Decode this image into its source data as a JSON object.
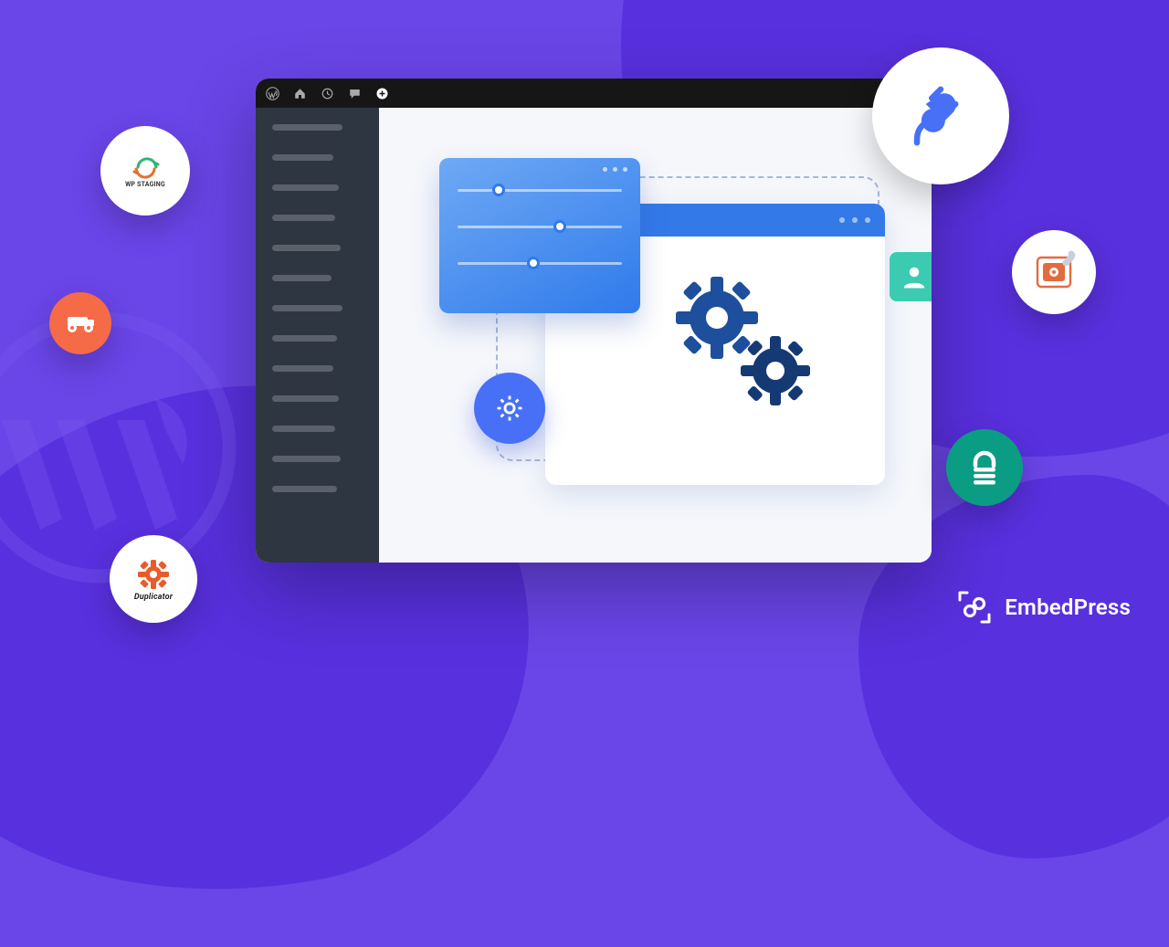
{
  "brand": {
    "name": "EmbedPress"
  },
  "badges": {
    "wpstaging": "WP   STAGING",
    "duplicator": "Duplicator"
  },
  "colors": {
    "accent": "#6A45E8",
    "accent_dark": "#5930DE",
    "blue": "#3479E8",
    "teal": "#3ACBB2",
    "green": "#0B9D84",
    "orange": "#F56A47"
  }
}
